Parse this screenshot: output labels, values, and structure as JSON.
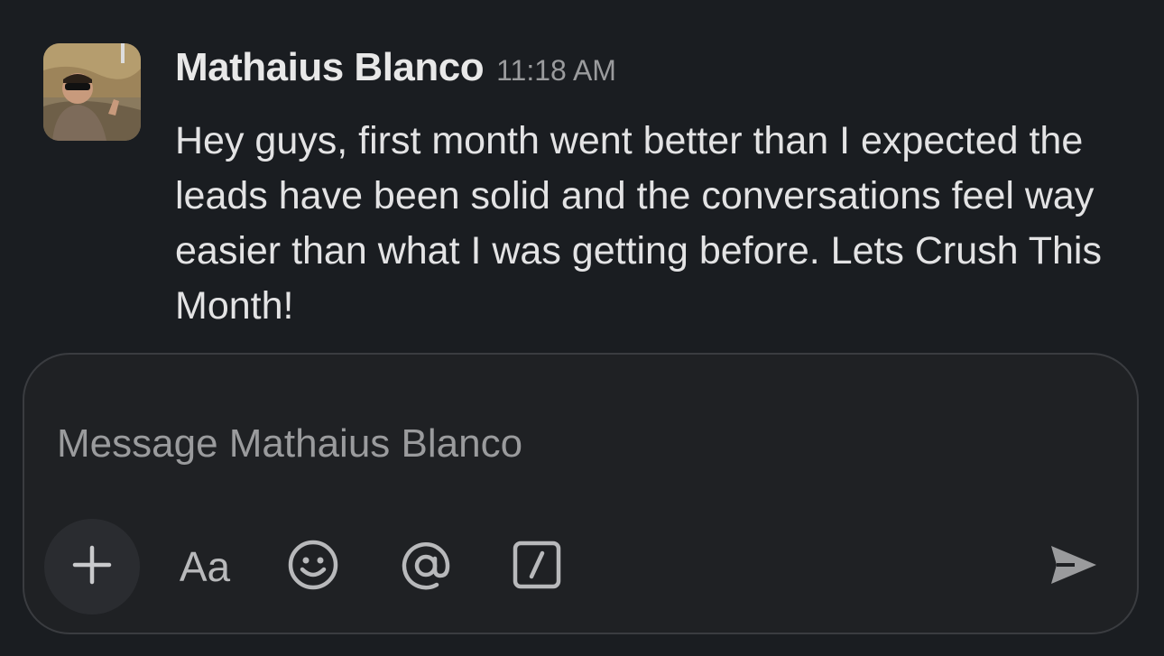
{
  "message": {
    "author": "Mathaius Blanco",
    "time": "11:18 AM",
    "body": "Hey guys, first month went better than I expected the leads have been solid and the conversations feel way easier than what I was getting before. Lets Crush This Month!"
  },
  "composer": {
    "placeholder": "Message Mathaius Blanco",
    "format_label": "Aa"
  },
  "colors": {
    "background": "#1a1d21",
    "composer_border": "#3a3c40",
    "text_primary": "#e3e3e4",
    "text_muted": "#9a9b9d"
  },
  "icons": [
    "plus-icon",
    "emoji-icon",
    "mention-icon",
    "slash-command-icon",
    "send-icon"
  ]
}
